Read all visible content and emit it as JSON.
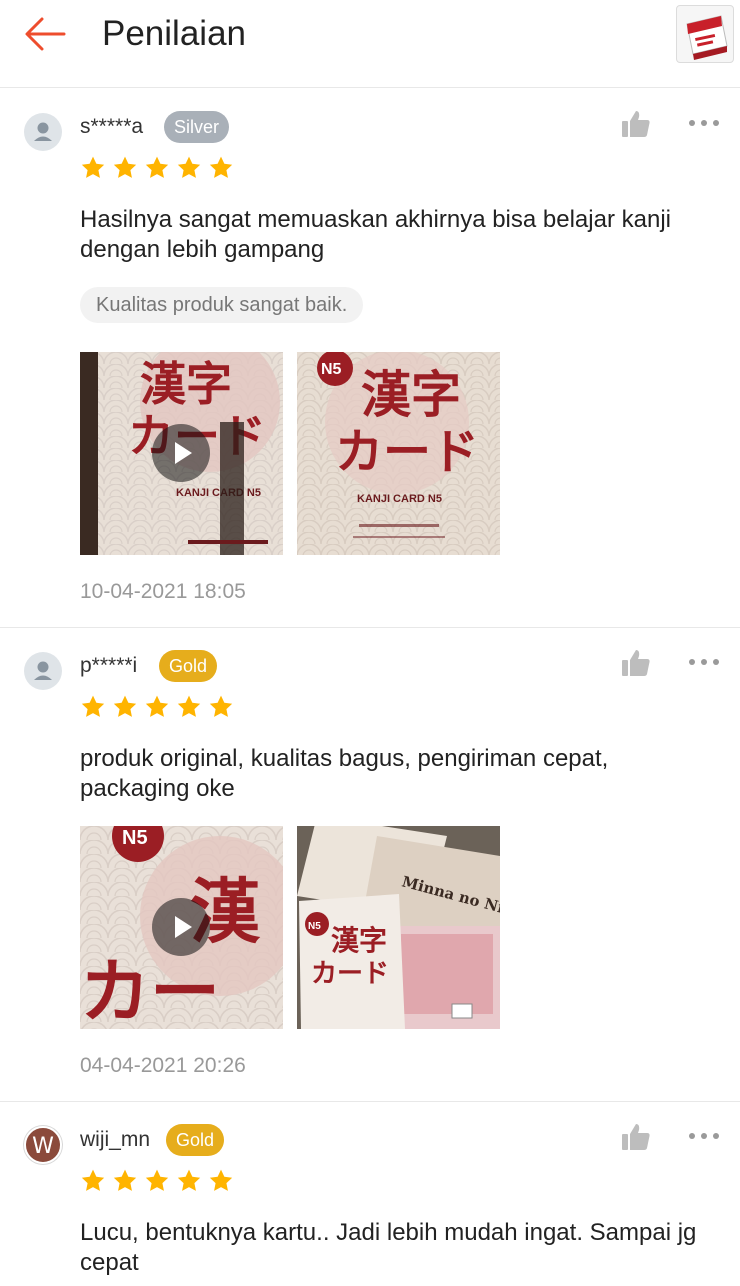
{
  "header": {
    "title": "Penilaian",
    "back_icon": "arrow-left-icon",
    "accent_color": "#ee4d2d"
  },
  "reviews": [
    {
      "username": "s*****a",
      "tier": "Silver",
      "rating": 5,
      "text": "Hasilnya sangat memuaskan akhirnya bisa belajar kanji dengan lebih gampang",
      "tag": "Kualitas produk sangat baik.",
      "media": [
        {
          "type": "video",
          "caption": "KANJI CARD N5"
        },
        {
          "type": "image",
          "caption": "KANJI CARD N5"
        }
      ],
      "date": "10-04-2021 18:05"
    },
    {
      "username": "p*****i",
      "tier": "Gold",
      "rating": 5,
      "text": "produk original, kualitas bagus, pengiriman cepat, packaging oke",
      "media": [
        {
          "type": "video"
        },
        {
          "type": "image",
          "caption": "Minna no Nihongo"
        }
      ],
      "date": "04-04-2021 20:26"
    },
    {
      "username": "wiji_mn",
      "avatar_letter": "W",
      "tier": "Gold",
      "rating": 5,
      "text": "Lucu, bentuknya kartu.. Jadi lebih mudah ingat. Sampai jg cepat"
    }
  ],
  "colors": {
    "star": "#ffb400",
    "silver_badge": "#a9b0b8",
    "gold_badge": "#e6ad1c",
    "divider": "#e8e8e8"
  }
}
